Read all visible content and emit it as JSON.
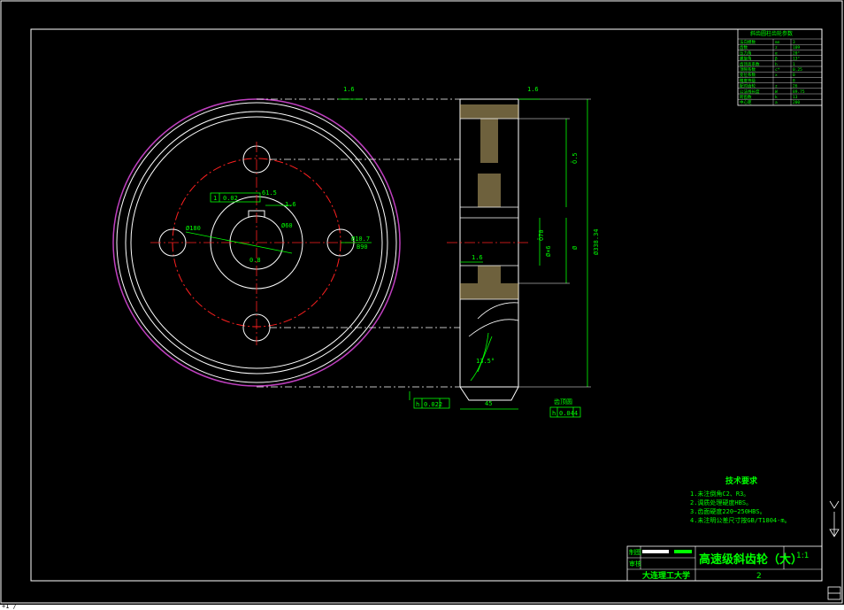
{
  "colors": {
    "background": "#000000",
    "outline": "#ffffff",
    "dimension": "#00ff00",
    "center_line": "#ff2020",
    "tip_circle": "#c040c0",
    "hatch": "#c8b070"
  },
  "front_view": {
    "roughness_top": "1.6",
    "keyway_dim": "61.5",
    "bore_dim": "Ø60",
    "hole_dim": "Ø8.2",
    "hole_pcd": "Ø180",
    "tol_box": "0.02",
    "tol_id": "1",
    "tol_val2": "12.5",
    "roughness_bore": "1.6",
    "roughness_center": "0.8",
    "hole_label_1": "Ø10.7",
    "hole_label_2": "B90"
  },
  "side_view": {
    "roughness_top": "1.6",
    "roughness_mid": "1.6",
    "dim_inner": "Ö.5",
    "dim_bore": "Ø×6",
    "dim_hub": "Ø",
    "dim_outer": "Ø338.34",
    "dim_width": "Ö70",
    "angle": "13.5°",
    "width_label": "45",
    "tol_left": "0.022",
    "tol_right": "0.044",
    "tol_sym": "h",
    "tol_sym2": "h",
    "ref_label": "齿顶圆"
  },
  "param_table": {
    "title": "斜齿圆柱齿轮参数",
    "rows": [
      [
        "法向模数",
        "mn",
        "3"
      ],
      [
        "齿数",
        "z",
        "109"
      ],
      [
        "压力角",
        "α",
        "20°"
      ],
      [
        "螺旋角",
        "β",
        "13°"
      ],
      [
        "齿顶高系数",
        "h",
        "1"
      ],
      [
        "顶隙系数",
        "c*",
        "0.25"
      ],
      [
        "变位系数",
        "x",
        "0"
      ],
      [
        "精度等级",
        "",
        "8"
      ],
      [
        "配对齿轮",
        "z",
        "26"
      ],
      [
        "公法线长度",
        "W",
        "89.75"
      ],
      [
        "跨齿数",
        "k",
        "13"
      ],
      [
        "中心距",
        "a",
        "200"
      ]
    ]
  },
  "tech_req": {
    "title": "技术要求",
    "items": [
      "1.未注倒角C2、R3。",
      "2.调质处理硬度HBS。",
      "3.齿面硬度220~250HBS。",
      "4.未注明公差尺寸按GB/T1804-m。"
    ]
  },
  "title_block": {
    "drawing_name": "高速级斜齿轮（大）",
    "scale": "1:1",
    "school": "大连理工大学",
    "sheet": "2",
    "label_draw": "制图",
    "label_check": "审核"
  },
  "ucs": {
    "y": "Y",
    "label": "+1 /"
  }
}
